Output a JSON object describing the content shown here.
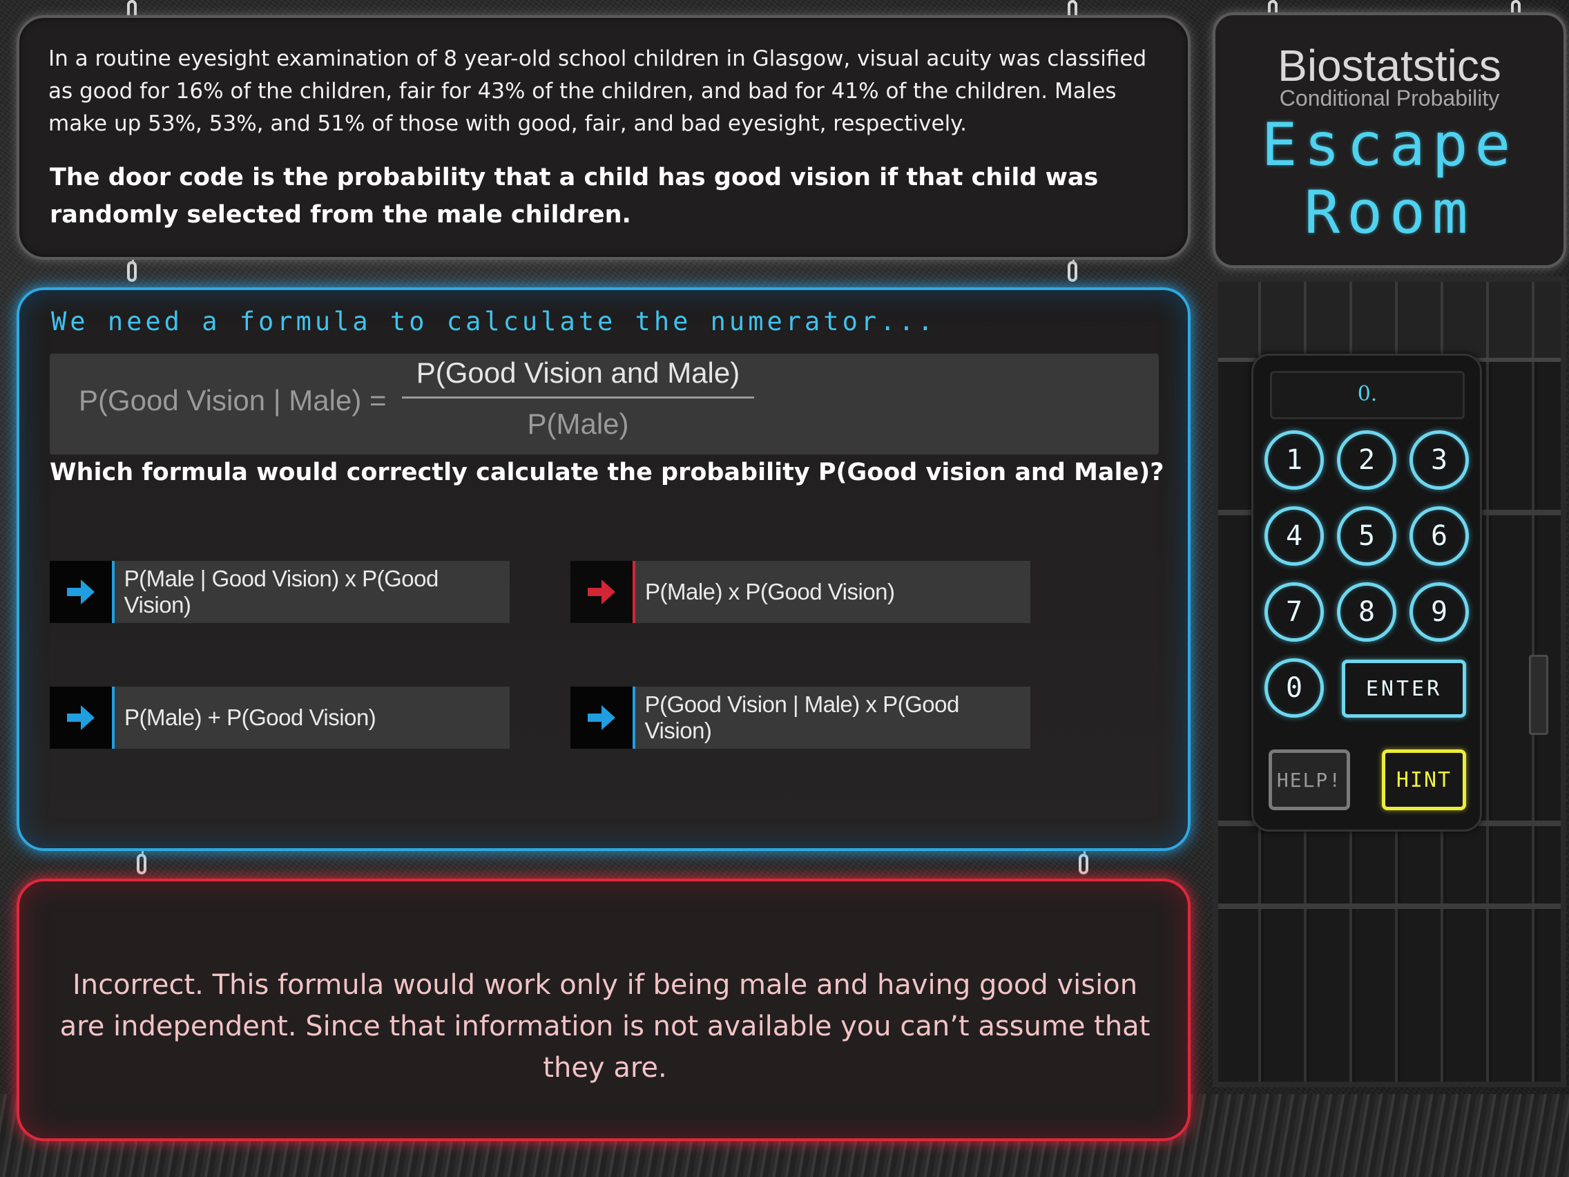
{
  "problem": {
    "text": "In a routine eyesight examination of 8 year-old school children in Glasgow, visual acuity was classified as good for 16% of the children, fair for 43% of the children, and bad for 41% of the children. Males make up 53%, 53%, and 51% of those with good, fair, and bad eyesight, respectively.",
    "door_code": "The door code is the probability that a child has good vision if that child was randomly selected from the male children."
  },
  "question": {
    "heading": "We need a formula to calculate the numerator...",
    "formula": {
      "lhs": "P(Good Vision | Male) =",
      "numerator": "P(Good Vision and Male)",
      "denominator": "P(Male)"
    },
    "prompt": "Which formula would correctly calculate the probability P(Good vision and Male)?",
    "options": [
      {
        "label": "P(Male | Good Vision) x P(Good Vision)",
        "state": "default"
      },
      {
        "label": "P(Male) x P(Good Vision)",
        "state": "selected"
      },
      {
        "label": "P(Male) + P(Good Vision)",
        "state": "default"
      },
      {
        "label": "P(Good Vision | Male) x P(Good Vision)",
        "state": "default"
      }
    ]
  },
  "feedback": {
    "text": "Incorrect. This formula would work only if being male and having good vision are independent. Since that information is not available you can’t assume that they are."
  },
  "title": {
    "main": "Biostatstics",
    "sub": "Conditional Probability",
    "escape": "Escape",
    "room": "Room"
  },
  "keypad": {
    "display": "0.",
    "keys": [
      "1",
      "2",
      "3",
      "4",
      "5",
      "6",
      "7",
      "8",
      "9",
      "0"
    ],
    "enter": "ENTER",
    "help": "HELP!",
    "hint": "HINT"
  },
  "colors": {
    "accent_blue": "#2fa9e0",
    "error_red": "#e0283a",
    "arrow_blue": "#1f9ee0",
    "arrow_red": "#d32635",
    "hint_yellow": "#ecec3a"
  },
  "icons": {
    "option_arrow": "arrow-right-icon"
  }
}
